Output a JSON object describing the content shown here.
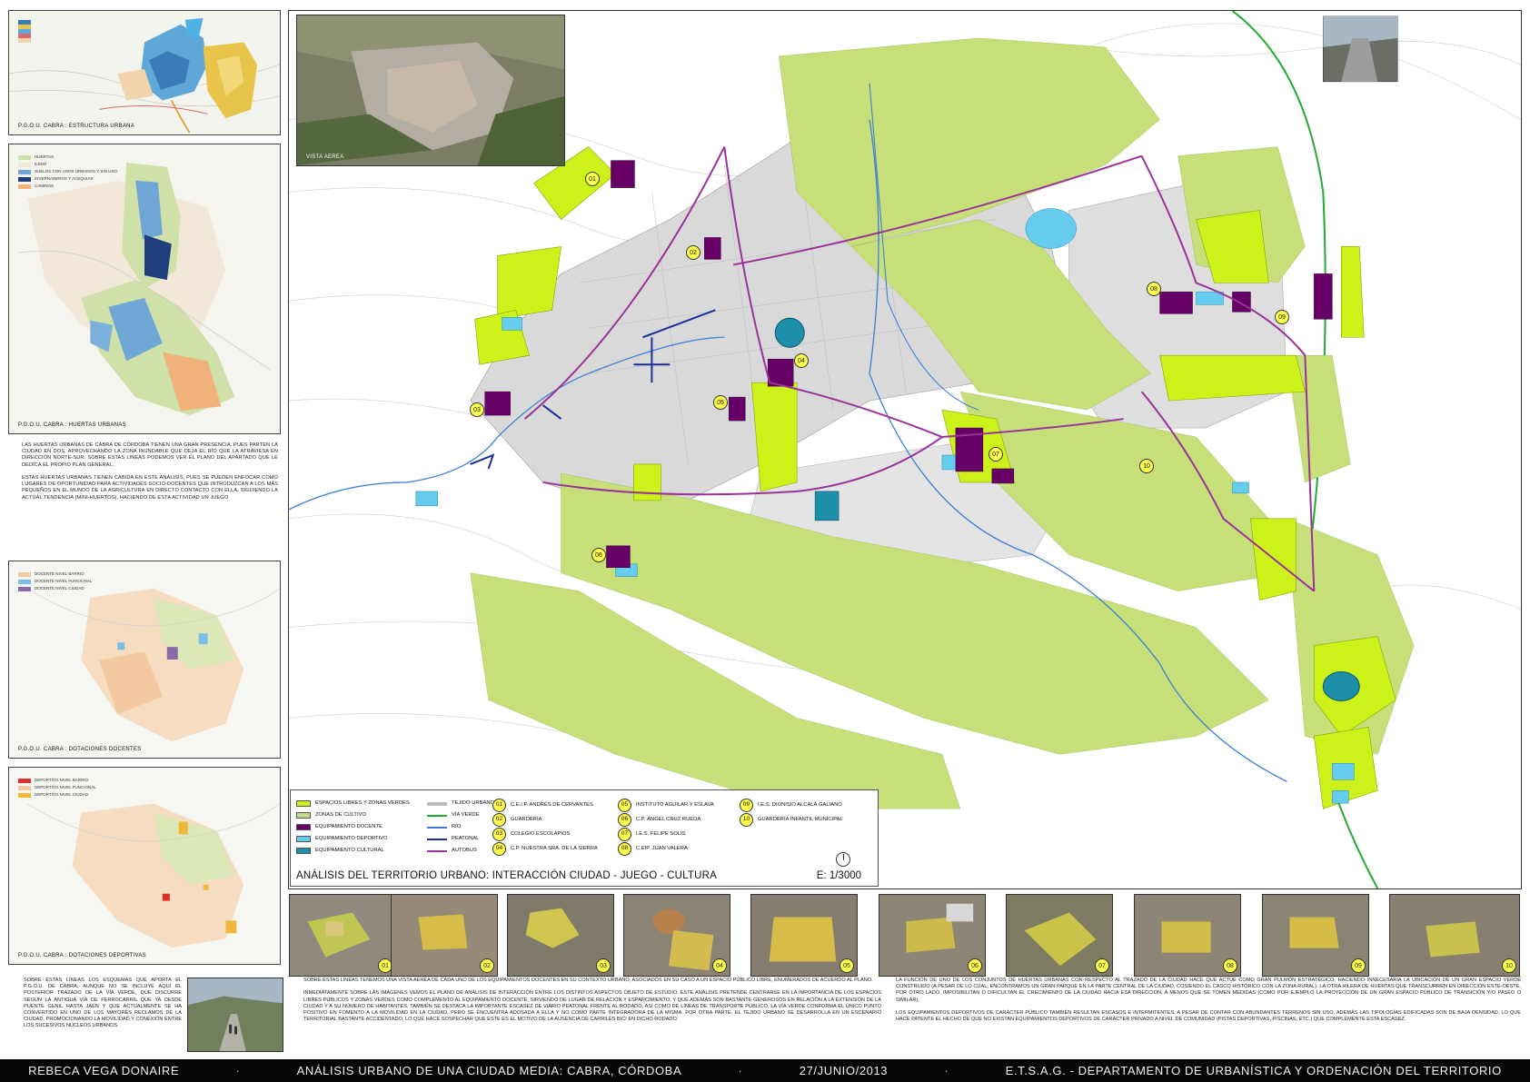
{
  "left_panels": {
    "estructura": {
      "caption": "P.G.O.U. CABRA : ESTRUCTURA URBANA"
    },
    "huertas": {
      "caption": "P.G.O.U. CABRA : HUERTAS URBANAS",
      "legend": [
        "HUERTAS",
        "EJIDO",
        "SUELOS CON USOS URBANOS Y SIN USO",
        "INVERNADEROS Y ACEQUIAS",
        "CAMINOS"
      ]
    },
    "docentes": {
      "caption": "P.G.O.U. CABRA : DOTACIONES DOCENTES",
      "legend": [
        "DOCENTE NIVEL BARRIO",
        "DOCENTE NIVEL FUNCIONAL",
        "DOCENTE NIVEL CIUDAD"
      ]
    },
    "deportivas": {
      "caption": "P.G.O.U. CABRA : DOTACIONES DEPORTIVAS",
      "legend": [
        "DEPORTIVO NIVEL BARRIO",
        "DEPORTIVO NIVEL FUNCIONAL",
        "DEPORTIVO NIVEL CIUDAD"
      ]
    }
  },
  "aerial": {
    "caption": "VISTA AEREA"
  },
  "text_huertas": "Las huertas urbanas de Cabra de Córdoba tienen una gran presencia, pues parten la ciudad en dos, aprovechando la zona inundable que deja el río que la atraviesa en dirección norte-sur. Sobre estas líneas podemos ver el plano del apartado que le dedica el propio plan general.\n\nEstas huertas urbanas tienen cabida en este análisis, pues se pueden enfocar como lugares de oportunidad para actividades socio-docentes que introduzcan a los más pequeños en el mundo de la agricultura en directo contacto con ella, siguiendo la actual tendencia (mini-huertos), haciendo de esta actividad un juego.",
  "text_bottom_left": "Sobre estas líneas los esquemas que aporta el P.G.O.U. de Cabra, aunque no se incluye aquí el posterior trazado de la vía verde, que discurre según la antigua vía de ferrocarril que ya desde puente Genil hasta Jaén y que actualmente se ha convertido en uno de los mayores reclamos de la ciudad, promocionando la movilidad y conexión entre los sucesivos núcleos urbanos.",
  "text_bottom_mid": "Sobre estas líneas tenemos una vista aérea de cada uno de los equipamientos docentes en su contexto urbano, asociados en su caso a un espacio público libre, enumerados de acuerdo al plano.\n\nInmediatamente sobre las imágenes vemos el plano de análisis de interacción entre los distintos aspectos objeto de estudio. Este análisis pretende centrarse en la importancia de los espacios libres públicos y zonas verdes como complemento al equipamiento docente, sirviendo de lugar de relación y esparcimiento, y que además son bastante generosos en relación a la extensión de la ciudad y a su número de habitantes. También se destaca la importante escasez de viario peatonal frente al rodado, así como de líneas de transporte público. La vía verde conforma el único punto positivo en fomento a la movilidad en la ciudad, pero se encuentra adosada a ella y no como parte integradora de la misma. Por otra parte, el tejido urbano se desarrolla en un escenario territorial bastante accidentado, lo que hace sospechar que este es el motivo de la ausencia de carriles bici en dicho rodado.",
  "text_bottom_right": "La función de uno de los conjuntos de huertas urbanas con respecto al trazado de la ciudad hace que actúe como gran pulmón estratégico, haciendo innecesaria la ubicación de un gran espacio verde construido (a pesar de lo cual, encontramos un gran parque en la parte central de la ciudad, cosiendo el casco histórico con la zona rural). La otra hilera de huertas que transcurren en dirección este-oeste, por otro lado, imposibilitan o dificultan el crecimiento de la ciudad hacia esa dirección, a menos que se tomen medidas (como por ejemplo la proyección de un gran espacio público de transición y/o paseo o similar).\n\nLos equipamientos deportivos de carácter público también resultan escasos e intermitentes, a pesar de contar con abundantes terrenos sin uso. Además las tipologías edificadas son de baja densidad, lo que hace patente el hecho de que no existan equipamientos deportivos de carácter privado a nivel de comunidad (pistas deportivas, piscinas, etc.) que complemente esta escasez.",
  "legend": {
    "col1": [
      {
        "label": "ESPACIOS LIBRES Y ZONAS VERDES",
        "color": "#ccf21a"
      },
      {
        "label": "ZONAS DE CULTIVO",
        "color": "#c2d98e"
      },
      {
        "label": "EQUIPAMIENTO DOCENTE",
        "color": "#660066"
      },
      {
        "label": "EQUIPAMIENTO DEPORTIVO",
        "color": "#66ccee"
      },
      {
        "label": "EQUIPAMIENTO CULTURAL",
        "color": "#1e8fa8"
      }
    ],
    "col2": [
      {
        "label": "TEJIDO URBANO",
        "color": "#bbbbbb"
      },
      {
        "label": "VÍA VERDE",
        "color": "#22aa33"
      },
      {
        "label": "RÍO",
        "color": "#4477dd"
      },
      {
        "label": "PEATONAL",
        "color": "#1a2e99"
      },
      {
        "label": "AUTOBUS",
        "color": "#993399"
      }
    ],
    "col3": [
      {
        "num": "01",
        "label": "C.E.I.P. ANDRÉS DE CERVANTES"
      },
      {
        "num": "02",
        "label": "GUARDERÍA"
      },
      {
        "num": "03",
        "label": "COLEGIO ESCOLAPIOS"
      },
      {
        "num": "04",
        "label": "C.P. NUESTRA SRA. DE LA SIERRA"
      }
    ],
    "col4": [
      {
        "num": "05",
        "label": "INSTITUTO AGUILAR Y ESLAVA"
      },
      {
        "num": "06",
        "label": "C.P. ÁNGEL CRUZ RUEDA"
      },
      {
        "num": "07",
        "label": "I.E.S. FELIPE SOLÍS"
      },
      {
        "num": "08",
        "label": "C.EIP. JUAN VALERA"
      }
    ],
    "col5": [
      {
        "num": "09",
        "label": "I.E.S. DIONISIO ALCALÁ GALIANO"
      },
      {
        "num": "10",
        "label": "GUARDERÍA INFANTIL MUNICIPAL"
      }
    ],
    "title": "ANÁLISIS DEL TERRITORIO URBANO: INTERACCIÓN CIUDAD - JUEGO - CULTURA",
    "scale": "E: 1/3000"
  },
  "map_markers": [
    "01",
    "02",
    "03",
    "04",
    "05",
    "06",
    "07",
    "08",
    "09",
    "10"
  ],
  "thumbnails": [
    "01",
    "02",
    "03",
    "04",
    "05",
    "06",
    "07",
    "08",
    "09",
    "10"
  ],
  "footer": {
    "author": "REBECA VEGA DONAIRE",
    "title": "ANÁLISIS URBANO DE UNA CIUDAD MEDIA: CABRA, CÓRDOBA",
    "date": "27/JUNIO/2013",
    "school": "E.T.S.A.G. - DEPARTAMENTO DE URBANÍSTICA Y ORDENACIÓN DEL TERRITORIO",
    "separator": "·"
  }
}
